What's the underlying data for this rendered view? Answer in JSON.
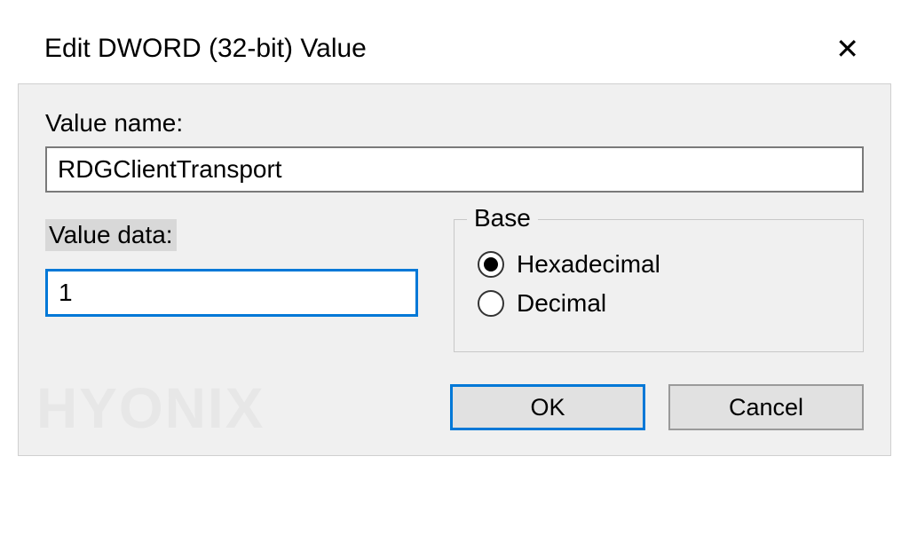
{
  "dialog": {
    "title": "Edit DWORD (32-bit) Value",
    "value_name_label": "Value name:",
    "value_name": "RDGClientTransport",
    "value_data_label": "Value data:",
    "value_data": "1",
    "base_legend": "Base",
    "radio_hex": "Hexadecimal",
    "radio_dec": "Decimal",
    "base_selected": "hex",
    "ok_label": "OK",
    "cancel_label": "Cancel"
  },
  "watermark": "HYONIX"
}
